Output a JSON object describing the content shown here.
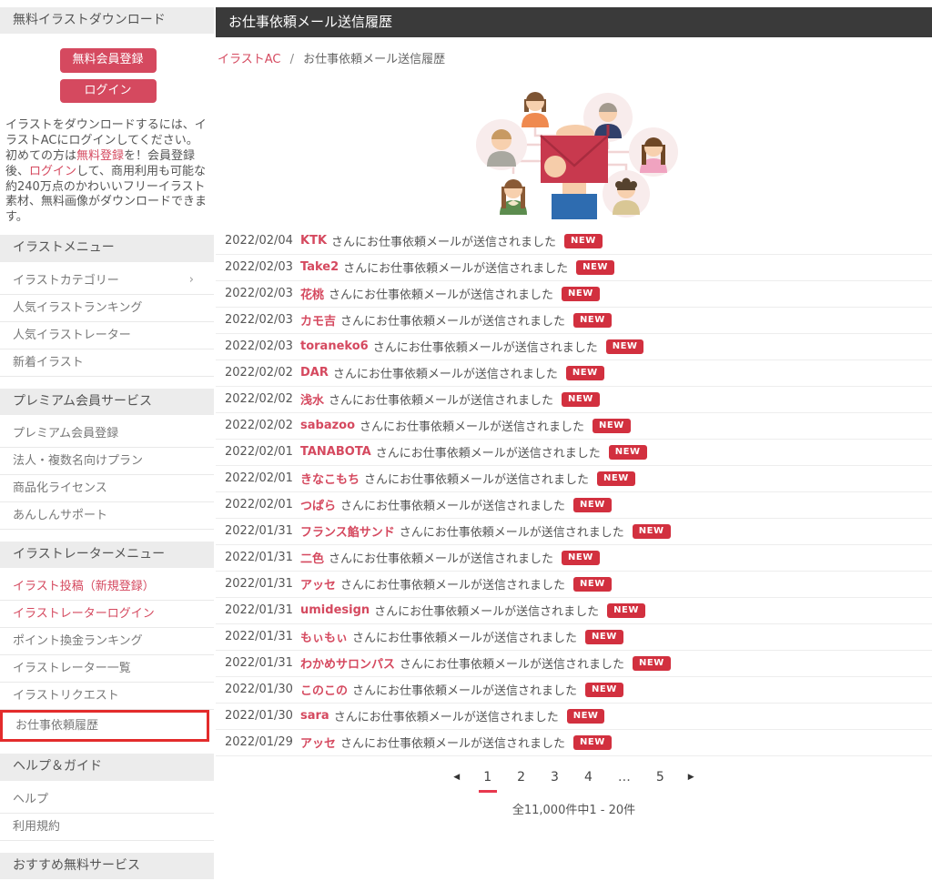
{
  "colors": {
    "accent": "#d5495f",
    "badge": "#d2303f",
    "title_bar": "#3a3a3a",
    "highlight_border": "#e32b2b"
  },
  "sidebar": {
    "download_header": "無料イラストダウンロード",
    "signup_button": "無料会員登録",
    "login_button": "ログイン",
    "chevron_glyph": "›",
    "description": [
      {
        "text": "イラストをダウンロードするには、イラストACにログインしてください。初めての方は",
        "link": false
      },
      {
        "text": "無料登録",
        "link": true
      },
      {
        "text": "を！会員登録後、",
        "link": false
      },
      {
        "text": "ログイン",
        "link": true
      },
      {
        "text": "して、商用利用も可能な約240万点のかわいいフリーイラスト素材、無料画像がダウンロードできます。",
        "link": false
      }
    ],
    "sections": [
      {
        "header": "イラストメニュー",
        "items": [
          {
            "label": "イラストカテゴリー",
            "chevron": true
          },
          {
            "label": "人気イラストランキング"
          },
          {
            "label": "人気イラストレーター"
          },
          {
            "label": "新着イラスト"
          }
        ]
      },
      {
        "header": "プレミアム会員サービス",
        "items": [
          {
            "label": "プレミアム会員登録"
          },
          {
            "label": "法人・複数名向けプラン"
          },
          {
            "label": "商品化ライセンス"
          },
          {
            "label": "あんしんサポート"
          }
        ]
      },
      {
        "header": "イラストレーターメニュー",
        "items": [
          {
            "label": "イラスト投稿（新規登録）",
            "red": true
          },
          {
            "label": "イラストレーターログイン",
            "red": true
          },
          {
            "label": "ポイント換金ランキング"
          },
          {
            "label": "イラストレーター一覧"
          },
          {
            "label": "イラストリクエスト"
          },
          {
            "label": "お仕事依頼履歴",
            "highlighted": true
          }
        ]
      },
      {
        "header": "ヘルプ＆ガイド",
        "items": [
          {
            "label": "ヘルプ"
          },
          {
            "label": "利用規約"
          }
        ]
      },
      {
        "header": "おすすめ無料サービス",
        "items": []
      }
    ]
  },
  "main": {
    "title": "お仕事依頼メール送信履歴",
    "breadcrumb": {
      "home": "イラストAC",
      "separator": "/",
      "current": "お仕事依頼メール送信履歴"
    },
    "message_suffix": "さんにお仕事依頼メールが送信されました",
    "badge_label": "NEW",
    "entries": [
      {
        "date": "2022/02/04",
        "name": "KTK"
      },
      {
        "date": "2022/02/03",
        "name": "Take2"
      },
      {
        "date": "2022/02/03",
        "name": "花桃"
      },
      {
        "date": "2022/02/03",
        "name": "カモ吉"
      },
      {
        "date": "2022/02/03",
        "name": "toraneko6"
      },
      {
        "date": "2022/02/02",
        "name": "DAR"
      },
      {
        "date": "2022/02/02",
        "name": "浅水"
      },
      {
        "date": "2022/02/02",
        "name": "sabazoo"
      },
      {
        "date": "2022/02/01",
        "name": "TANABOTA"
      },
      {
        "date": "2022/02/01",
        "name": "きなこもち"
      },
      {
        "date": "2022/02/01",
        "name": "つぱら"
      },
      {
        "date": "2022/01/31",
        "name": "フランス餡サンド"
      },
      {
        "date": "2022/01/31",
        "name": "二色"
      },
      {
        "date": "2022/01/31",
        "name": "アッセ"
      },
      {
        "date": "2022/01/31",
        "name": "umidesign"
      },
      {
        "date": "2022/01/31",
        "name": "もぃもぃ"
      },
      {
        "date": "2022/01/31",
        "name": "わかめサロンパス"
      },
      {
        "date": "2022/01/30",
        "name": "このこの"
      },
      {
        "date": "2022/01/30",
        "name": "sara"
      },
      {
        "date": "2022/01/29",
        "name": "アッセ"
      }
    ],
    "pagination": {
      "prev_icon": "◀",
      "next_icon": "▶",
      "pages": [
        "1",
        "2",
        "3",
        "4",
        "…",
        "5"
      ],
      "current": "1"
    },
    "total": "全11,000件中1 - 20件"
  }
}
